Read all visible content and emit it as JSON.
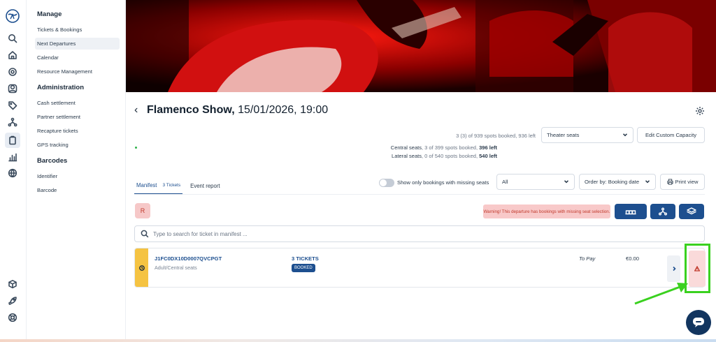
{
  "nav": {
    "sections": [
      {
        "title": "Manage",
        "items": [
          "Tickets & Bookings",
          "Next Departures",
          "Calendar",
          "Resource Management"
        ]
      },
      {
        "title": "Administration",
        "items": [
          "Cash settlement",
          "Partner settlement",
          "Recapture tickets",
          "GPS tracking"
        ]
      },
      {
        "title": "Barcodes",
        "items": [
          "Identifier",
          "Barcode"
        ]
      }
    ]
  },
  "header": {
    "title_bold": "Flamenco Show,",
    "title_rest": " 15/01/2026, 19:00"
  },
  "capacity": {
    "summary": "3 (3) of 939 spots booked, 936 left",
    "seat_map_selected": "Theater seats",
    "edit_button": "Edit Custom Capacity",
    "zones": [
      {
        "name": "Central seats",
        "mid": ", 3 of 399 spots booked, ",
        "left": "396 left"
      },
      {
        "name": "Lateral seats",
        "mid": ", 0 of 540 spots booked, ",
        "left": "540 left"
      }
    ]
  },
  "tabs": {
    "manifest": "Manifest",
    "manifest_count": "3 Tickets",
    "event_report": "Event report"
  },
  "filters": {
    "toggle_label": "Show only bookings with missing seats",
    "status_selected": "All",
    "order_selected": "Order by: Booking date",
    "print_label": "Print view"
  },
  "toolbar": {
    "r_label": "R",
    "warning": "Warning! This departure has bookings with missing seat selection."
  },
  "search": {
    "placeholder": "Type to search for ticket in manifest ..."
  },
  "booking": {
    "reference": "J1FC0DX10D0007QVCPGT",
    "description": "Adult/Central seats",
    "tickets": "3 TICKETS",
    "status": "BOOKED",
    "payment": "To Pay",
    "amount": "€0.00"
  },
  "colors": {
    "primary": "#1d4f8f",
    "status_stripe": "#f5c342",
    "warning_bg": "#f8c9c9",
    "annotation": "#3ad11f"
  }
}
